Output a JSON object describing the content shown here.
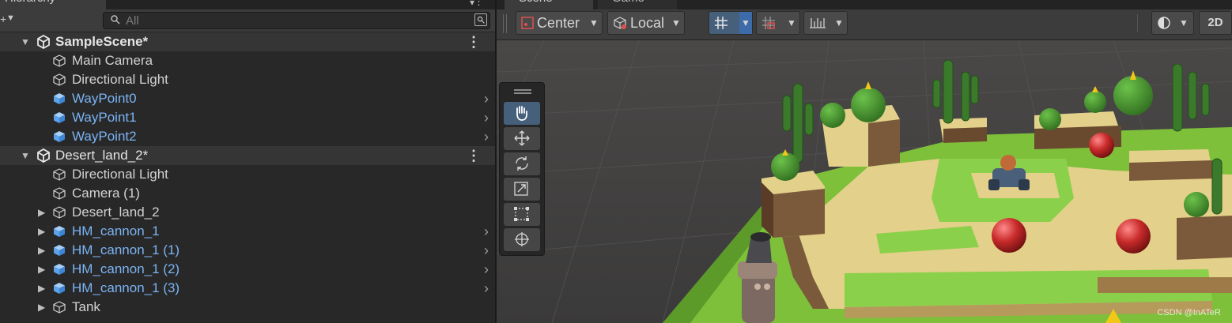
{
  "hierarchy": {
    "tab_title": "Hierarchy",
    "search": {
      "placeholder": "All"
    },
    "items": [
      {
        "name": "SampleScene*",
        "type": "scene"
      },
      {
        "name": "Main Camera",
        "type": "object"
      },
      {
        "name": "Directional Light",
        "type": "object"
      },
      {
        "name": "WayPoint0",
        "type": "prefab"
      },
      {
        "name": "WayPoint1",
        "type": "prefab"
      },
      {
        "name": "WayPoint2",
        "type": "prefab"
      },
      {
        "name": "Desert_land_2*",
        "type": "scene"
      },
      {
        "name": "Directional Light",
        "type": "object"
      },
      {
        "name": "Camera (1)",
        "type": "object"
      },
      {
        "name": "Desert_land_2",
        "type": "object",
        "collapsed": true
      },
      {
        "name": "HM_cannon_1",
        "type": "prefab",
        "collapsed": true
      },
      {
        "name": "HM_cannon_1 (1)",
        "type": "prefab",
        "collapsed": true
      },
      {
        "name": "HM_cannon_1 (2)",
        "type": "prefab",
        "collapsed": true
      },
      {
        "name": "HM_cannon_1 (3)",
        "type": "prefab",
        "collapsed": true
      },
      {
        "name": "Tank",
        "type": "object",
        "collapsed": true
      }
    ]
  },
  "scene_view": {
    "tabs": [
      "Scene",
      "Game"
    ],
    "pivot_label": "Center",
    "space_label": "Local",
    "mode_2d_label": "2D",
    "tools": [
      "hand-tool",
      "move-tool",
      "rotate-tool",
      "scale-tool",
      "rect-tool",
      "transform-tool"
    ],
    "active_tool": "hand-tool"
  },
  "watermark": "CSDN @InATeR",
  "colors": {
    "panel_bg": "#282828",
    "prefab_text": "#7bb4f4",
    "active_button": "#46607c",
    "grass": "#7ec03a",
    "sand": "#e3d08a",
    "red_sphere": "#c92b2b"
  }
}
